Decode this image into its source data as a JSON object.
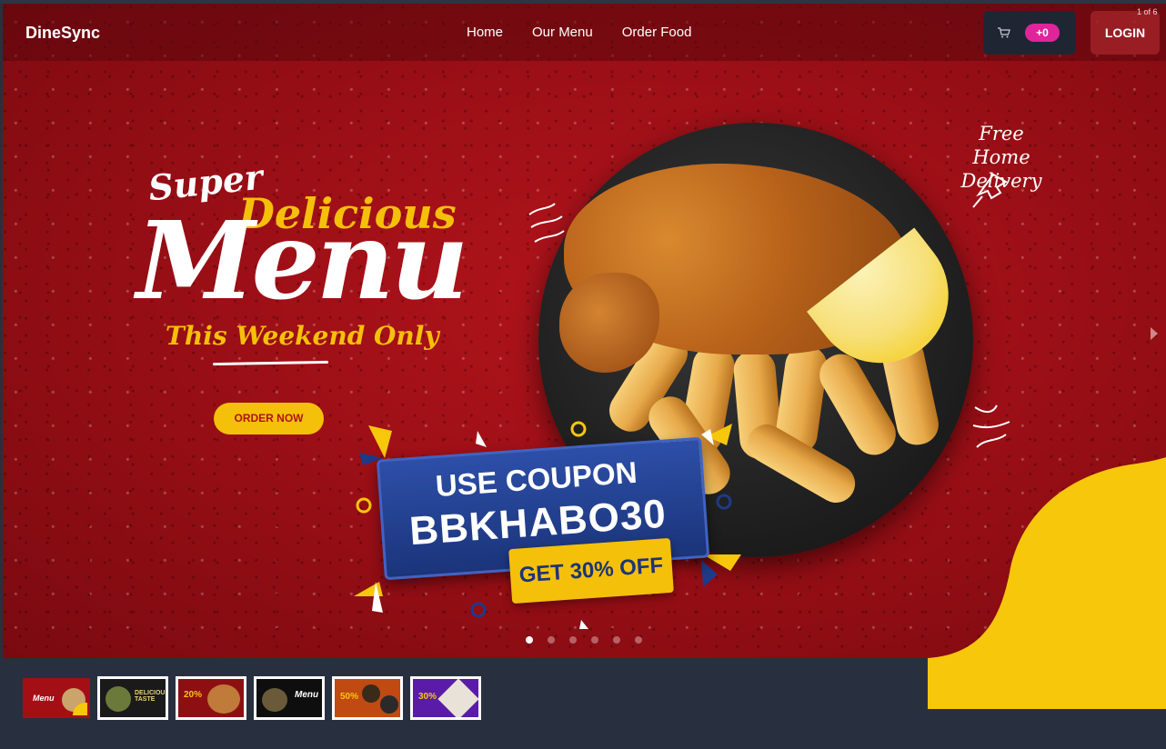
{
  "navbar": {
    "brand": "DineSync",
    "links": [
      "Home",
      "Our Menu",
      "Order Food"
    ],
    "cart_count": "+0",
    "login_label": "LOGIN",
    "slide_counter": "1 of 6"
  },
  "hero": {
    "super": "Super",
    "delicious": "Delicious",
    "menu": "Menu",
    "weekend": "This Weekend Only",
    "order_button": "ORDER NOW",
    "delivery_line1": "Free Home",
    "delivery_line2": "Delivery",
    "coupon_line1": "USE COUPON",
    "coupon_code": "BBKHABO30",
    "coupon_offer": "GET 30% OFF"
  },
  "carousel": {
    "slides": 6,
    "active_index": 0
  },
  "thumbnails": [
    {
      "label": "Menu",
      "bg": "#a40f16"
    },
    {
      "label": "DELICIOUS TASTE",
      "bg": "#1a1a1a"
    },
    {
      "label": "20%",
      "bg": "#8e0f12"
    },
    {
      "label": "Menu",
      "bg": "#0e0e0e"
    },
    {
      "label": "50%",
      "bg": "#c04a12"
    },
    {
      "label": "30%",
      "bg": "#5a1ca8"
    }
  ],
  "colors": {
    "brand_red": "#a3121a",
    "accent_yellow": "#f5c00a",
    "badge_pink": "#e0249a",
    "coupon_blue": "#1f3a88"
  },
  "icons": {
    "cart": "cart-icon",
    "next": "chevron-right-icon"
  }
}
